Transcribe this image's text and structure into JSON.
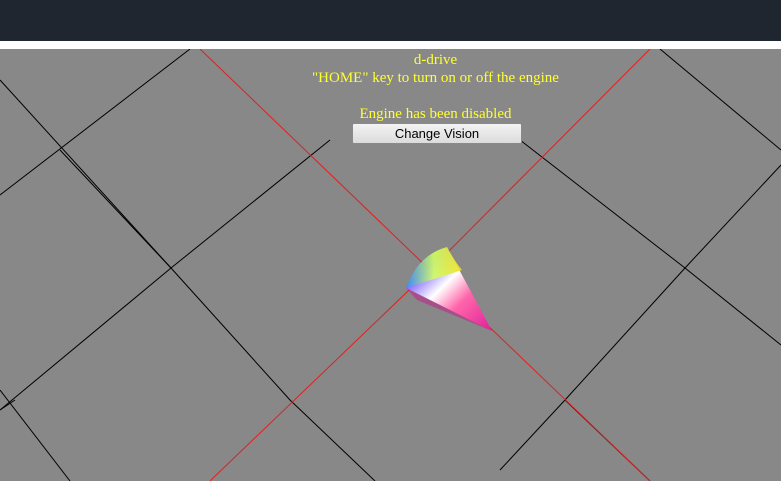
{
  "hud": {
    "title": "d-drive",
    "instruction": "\"HOME\" key to turn on or off the engine",
    "status": "Engine has been disabled"
  },
  "controls": {
    "change_vision_label": "Change Vision"
  },
  "colors": {
    "top_bar": "#1f2630",
    "ground": "#888888",
    "grid_line": "#000000",
    "axis_line": "#e02020",
    "hud_text": "#ffff33"
  },
  "scene": {
    "object": "cone",
    "object_coloring": "rainbow-gradient",
    "engine_enabled": false
  }
}
